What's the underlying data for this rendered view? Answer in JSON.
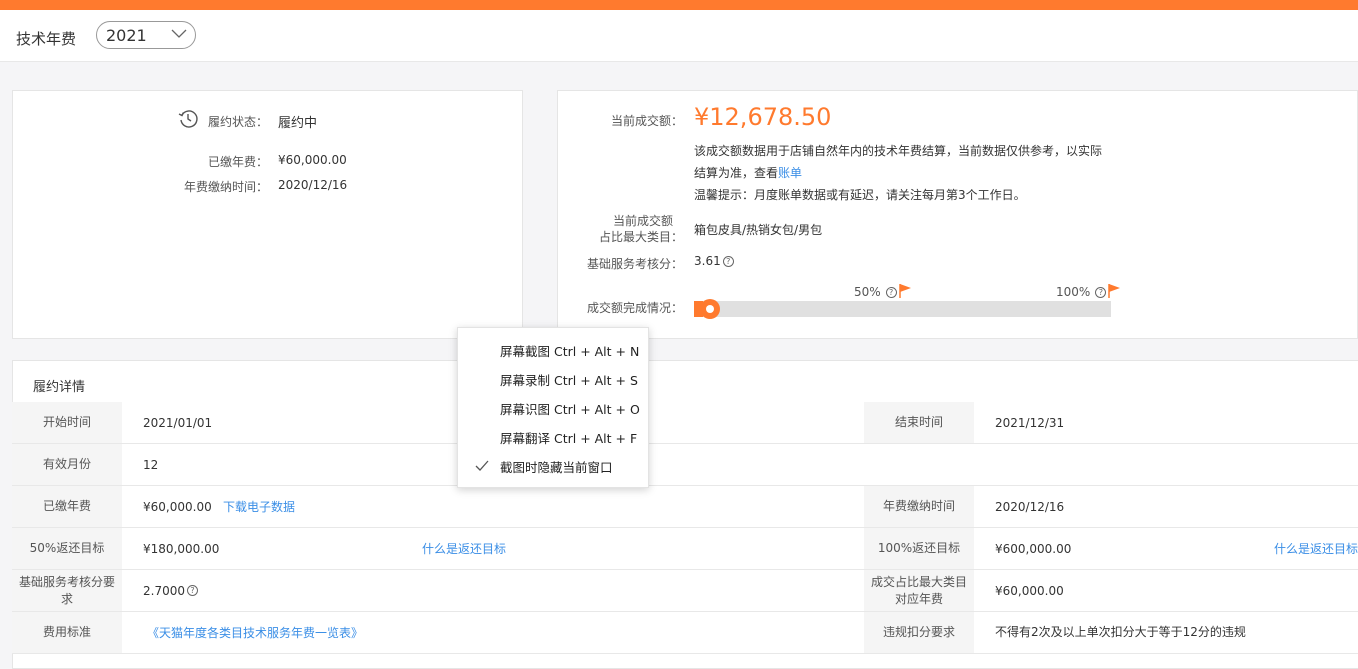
{
  "header": {
    "title": "技术年费",
    "year": "2021"
  },
  "left_card": {
    "status_label": "履约状态：",
    "status_value": "履约中",
    "paid_label": "已缴年费：",
    "paid_value": "¥60,000.00",
    "pay_time_label": "年费缴纳时间：",
    "pay_time_value": "2020/12/16"
  },
  "right_card": {
    "amount_label": "当前成交额：",
    "amount_value": "¥12,678.50",
    "desc_line1": "该成交额数据用于店铺自然年内的技术年费结算，当前数据仅供参考，以实际",
    "desc_line2_prefix": "结算为准，查看",
    "desc_link": "账单",
    "tip": "温馨提示：月度账单数据或有延迟，请关注每月第3个工作日。",
    "category_label_1": "当前成交额",
    "category_label_2": "占比最大类目：",
    "category_value": "箱包皮具/热销女包/男包",
    "service_label": "基础服务考核分：",
    "service_value": "3.61",
    "progress_label": "成交额完成情况：",
    "marker_50": "50%",
    "marker_100": "100%",
    "progress_fraction": 0.021,
    "accent_color": "#ff7a2e"
  },
  "details": {
    "title": "履约详情",
    "rows": [
      {
        "h1": "开始时间",
        "v1": "2021/01/01",
        "h2": "结束时间",
        "v2": "2021/12/31"
      },
      {
        "h1": "有效月份",
        "v1": "12"
      },
      {
        "h1": "已缴年费",
        "v1": "¥60,000.00",
        "link1": "下载电子数据",
        "h2": "年费缴纳时间",
        "v2": "2020/12/16"
      },
      {
        "h1": "50%返还目标",
        "v1": "¥180,000.00",
        "link1": "什么是返还目标",
        "h2": "100%返还目标",
        "v2": "¥600,000.00",
        "link2": "什么是返还目标"
      },
      {
        "h1": "基础服务考核分要求",
        "v1": "2.7000",
        "h2": "成交占比最大类目对应年费",
        "v2": "¥60,000.00"
      },
      {
        "h1": "费用标准",
        "v1": "《天猫年度各类目技术服务年费一览表》",
        "h2": "违规扣分要求",
        "v2": "不得有2次及以上单次扣分大于等于12分的违规"
      }
    ]
  },
  "context_menu": {
    "items": [
      "屏幕截图 Ctrl + Alt + N",
      "屏幕录制 Ctrl + Alt + S",
      "屏幕识图 Ctrl + Alt + O",
      "屏幕翻译 Ctrl + Alt + F",
      "截图时隐藏当前窗口"
    ],
    "checked_index": 4
  }
}
